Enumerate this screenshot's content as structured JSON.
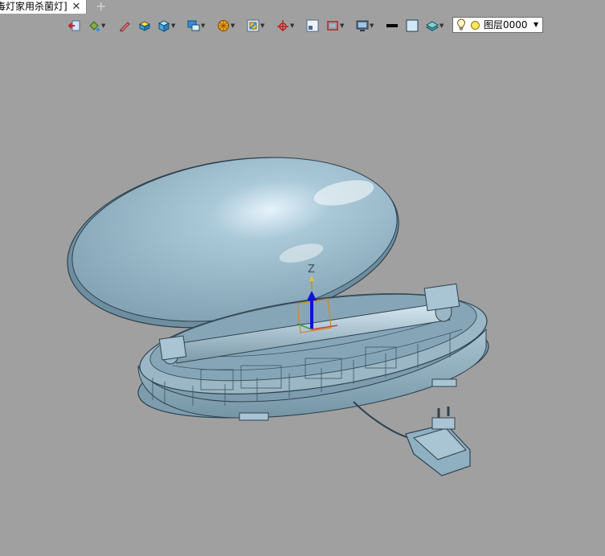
{
  "tab": {
    "title": "毒灯家用杀菌灯]",
    "close_symbol": "✕",
    "new_tab_symbol": "+"
  },
  "toolbar": {
    "buttons": [
      "exit-sketch-icon",
      "paint-bucket-icon",
      "pen-icon",
      "box-material-icon",
      "cube-view-icon",
      "display-mode-icon",
      "render-sphere-icon",
      "section-view-icon",
      "coordinate-axis-icon",
      "grid-icon",
      "dimension-icon",
      "monitor-icon",
      "line-color-swatch",
      "fill-color-swatch",
      "layers-icon"
    ],
    "layer": {
      "name": "图层0000"
    }
  },
  "viewport": {
    "triad_label": "Z",
    "background": "#a0a0a0",
    "model_color": "#8fb0c0"
  }
}
